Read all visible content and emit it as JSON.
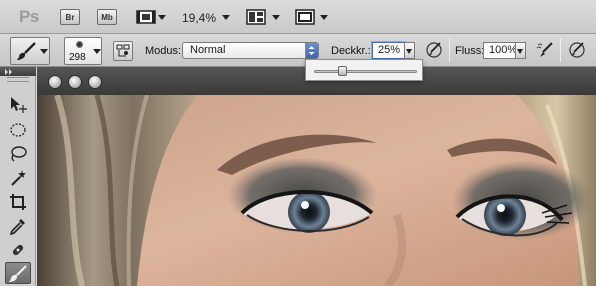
{
  "app": {
    "logo": "Ps",
    "bridge_label": "Br",
    "minibridge_label": "Mb",
    "zoom": "19,4%",
    "icons": [
      "film-strip-icon",
      "arrange-documents-icon",
      "screen-mode-icon"
    ]
  },
  "options": {
    "brush_size": "298",
    "modus_label": "Modus:",
    "modus_value": "Normal",
    "deckkr_label": "Deckkr.:",
    "deckkr_value": "25%",
    "fluss_label": "Fluss:",
    "fluss_value": "100%",
    "opacity_slider_level": 0.25
  },
  "tools": [
    "move-tool-icon",
    "marquee-tool-icon",
    "lasso-tool-icon",
    "magic-wand-tool-icon",
    "crop-tool-icon",
    "eyedropper-tool-icon",
    "healing-brush-tool-icon",
    "brush-tool-icon"
  ],
  "colors": {
    "accent_blue": "#4a6cc0",
    "chrome_dark": "#3a3a3a"
  }
}
